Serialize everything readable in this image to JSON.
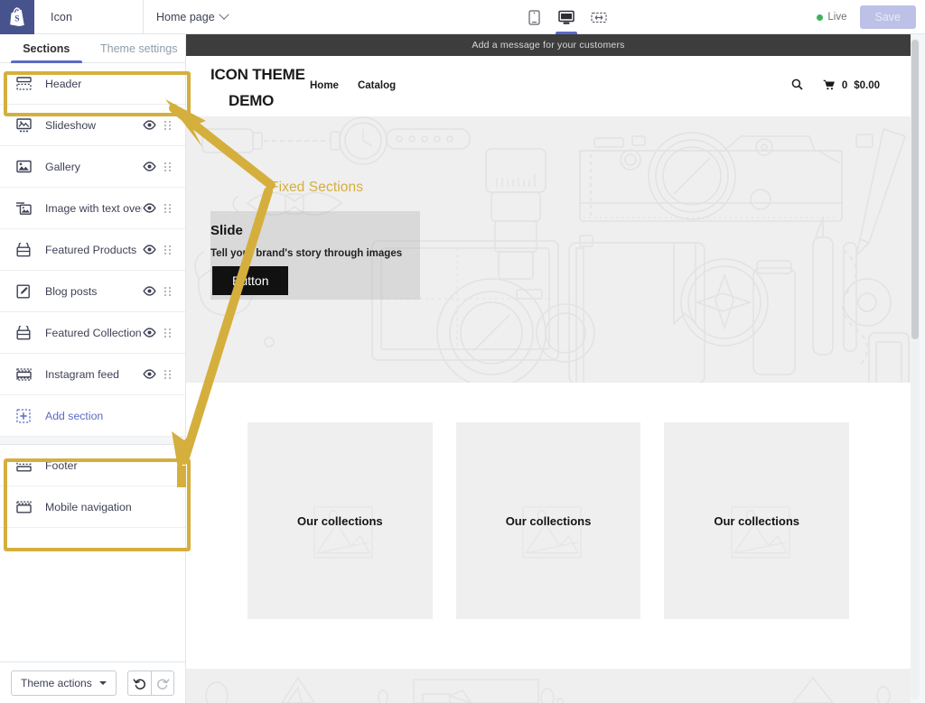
{
  "topbar": {
    "logo_icon": "shopify-bag-icon",
    "shop_name": "Icon",
    "page_selector": "Home page",
    "page_selector_icon": "chevron-down-icon",
    "devices": [
      {
        "name": "mobile-view",
        "icon": "mobile-icon",
        "active": false
      },
      {
        "name": "desktop-view",
        "icon": "desktop-icon",
        "active": true
      },
      {
        "name": "fullscreen-view",
        "icon": "fullscreen-icon",
        "active": false
      }
    ],
    "live_label": "Live",
    "save_label": "Save",
    "live_dot_color": "#3eb35a",
    "save_bg_color": "#bdc1e8"
  },
  "sidebar": {
    "tabs": [
      {
        "label": "Sections",
        "active": true
      },
      {
        "label": "Theme settings",
        "active": false
      }
    ],
    "accent_color": "#5c6ac4",
    "sections": [
      {
        "label": "Header",
        "icon": "header-layout-icon",
        "eye": false,
        "grip": false,
        "link": false
      },
      {
        "label": "Slideshow",
        "icon": "slideshow-icon",
        "eye": true,
        "grip": true,
        "link": false
      },
      {
        "label": "Gallery",
        "icon": "gallery-icon",
        "eye": true,
        "grip": true,
        "link": false
      },
      {
        "label": "Image with text over…",
        "icon": "image-with-text-icon",
        "eye": true,
        "grip": true,
        "link": false
      },
      {
        "label": "Featured Products",
        "icon": "featured-products-icon",
        "eye": true,
        "grip": true,
        "link": false
      },
      {
        "label": "Blog posts",
        "icon": "blog-posts-icon",
        "eye": true,
        "grip": true,
        "link": false
      },
      {
        "label": "Featured Collections",
        "icon": "featured-collections-icon",
        "eye": true,
        "grip": true,
        "link": false
      },
      {
        "label": "Instagram feed",
        "icon": "instagram-feed-icon",
        "eye": true,
        "grip": true,
        "link": false
      },
      {
        "label": "Add section",
        "icon": "add-section-icon",
        "eye": false,
        "grip": false,
        "link": true
      }
    ],
    "fixed_sections": [
      {
        "label": "Footer",
        "icon": "footer-layout-icon"
      },
      {
        "label": "Mobile navigation",
        "icon": "mobile-nav-icon"
      }
    ],
    "theme_actions_label": "Theme actions",
    "undo_icon": "undo-icon",
    "redo_icon": "redo-icon"
  },
  "preview": {
    "announcement": "Add a message for your customers",
    "brand_line1": "ICON THEME",
    "brand_line2": "DEMO",
    "nav": [
      "Home",
      "Catalog"
    ],
    "search_icon": "search-icon",
    "cart_icon": "cart-icon",
    "cart_count": "0",
    "cart_total": "$0.00",
    "slide": {
      "title": "Slide",
      "subtitle": "Tell your brand's story through images",
      "button": "Button"
    },
    "collections": [
      {
        "label": "Our collections"
      },
      {
        "label": "Our collections"
      },
      {
        "label": "Our collections"
      }
    ]
  },
  "annotations": {
    "label": "Fixed Sections",
    "color": "#d5af3d",
    "boxes": [
      "header-section-highlight",
      "fixed-sections-highlight"
    ],
    "arrow": "double-headed-arrow"
  }
}
